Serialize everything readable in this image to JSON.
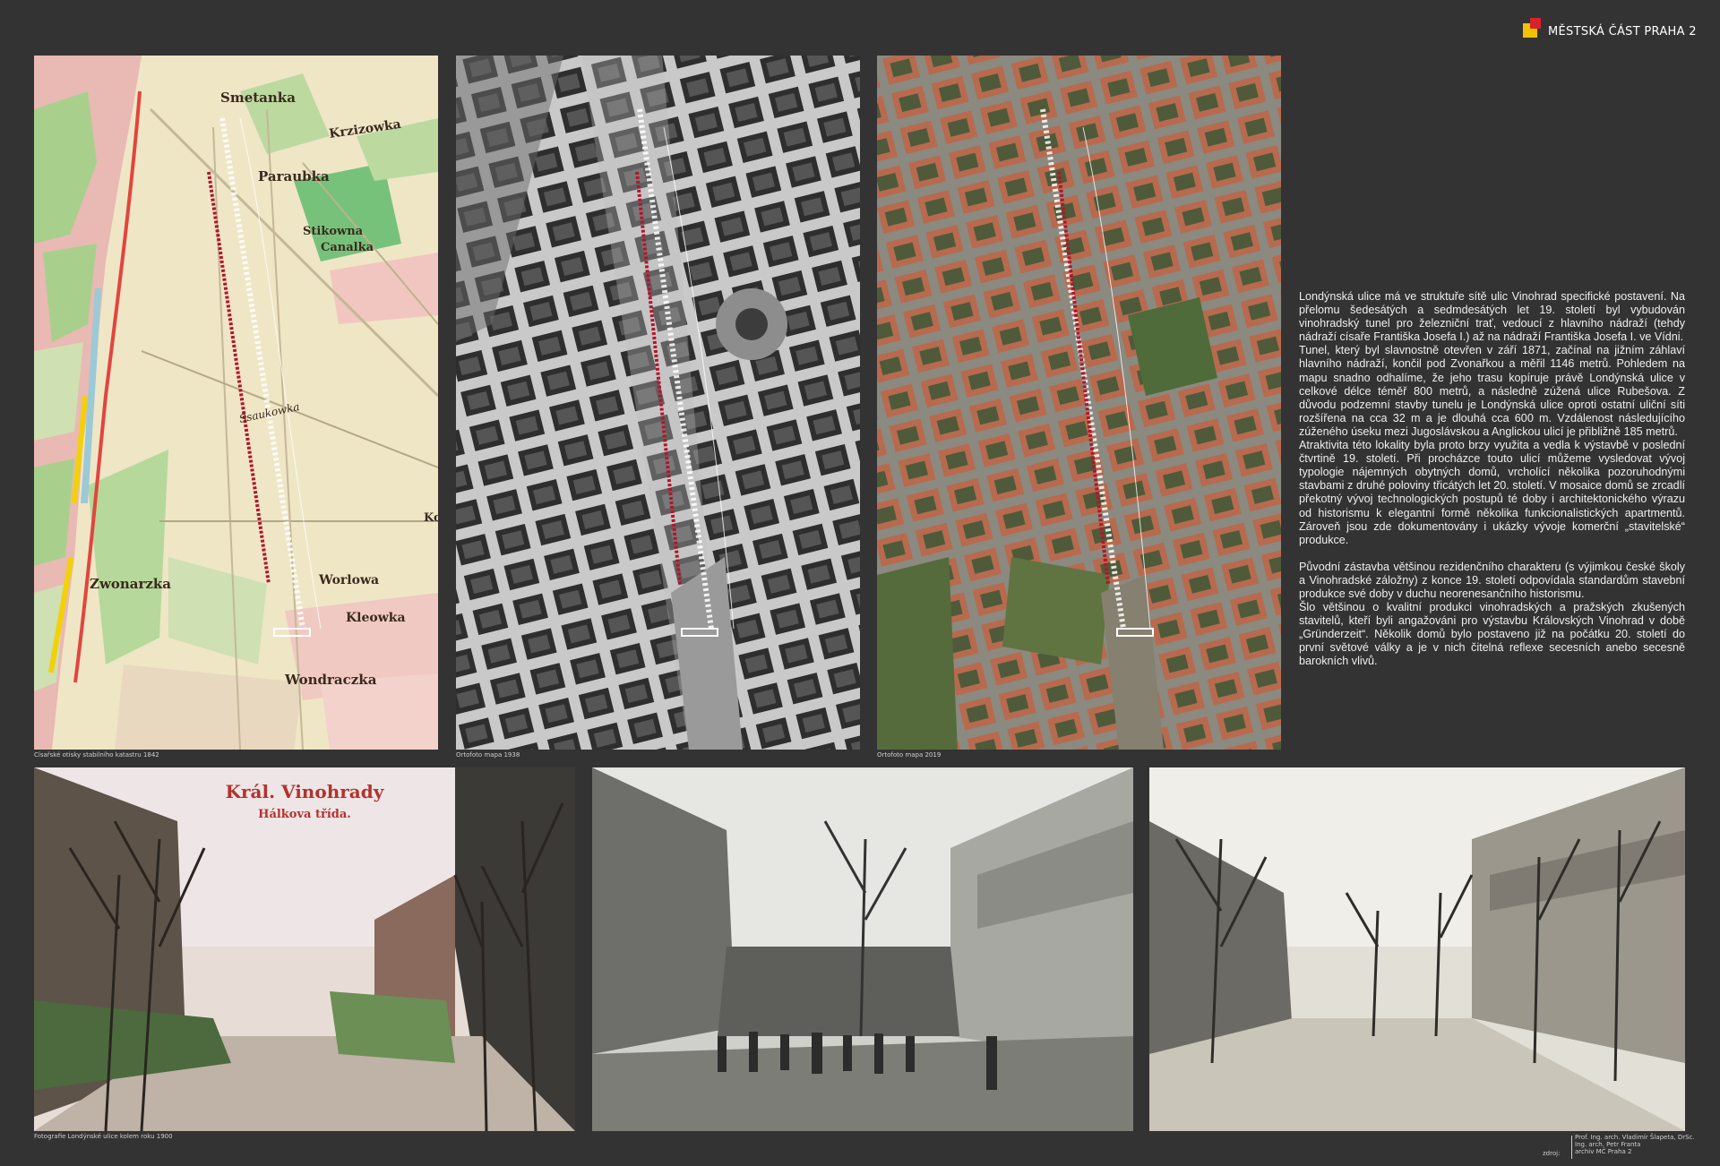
{
  "logo": {
    "text": "MĚSTSKÁ ČÁST PRAHA 2",
    "colors": {
      "yellow": "#f2c200",
      "red": "#d8222a"
    }
  },
  "maps": [
    {
      "caption": "Císařské otisky stabilního katastru 1842",
      "labels": [
        "Smetanka",
        "Krzizowka",
        "Paraubka",
        "Stikowna",
        "Canalka",
        "Ssaukowka",
        "Worlowa",
        "Zwonarzka",
        "Kleowka",
        "Wondraczka",
        "Ko"
      ]
    },
    {
      "caption": "Ortofoto mapa 1938"
    },
    {
      "caption": "Ortofoto mapa 2019"
    }
  ],
  "article": {
    "paragraphs": [
      "Londýnská ulice má ve struktuře sítě ulic Vinohrad specifické postavení. Na přelomu šedesátých a sedmdesátých let 19. století byl vybudován vinohradský tunel pro železniční trať, vedoucí z hlavního nádraží (tehdy nádraží císaře Františka Josefa I.) až na nádraží Františka Josefa I. ve Vídni.",
      "Tunel, který byl slavnostně otevřen v září 1871, začínal na jižním záhlaví hlavního nádraží, končil pod Zvonařkou a měřil 1146 metrů. Pohledem na mapu snadno odhalíme, že jeho trasu kopíruje právě Londýnská ulice v celkové délce téměř 800 metrů, a následně zúžená ulice Rubešova. Z důvodu podzemní stavby tunelu je Londýnská ulice oproti ostatní uliční síti rozšířena na cca 32 m a je dlouhá cca 600 m. Vzdálenost následujícího zúženého úseku mezi Jugoslávskou a Anglickou ulicí je přibližně 185 metrů.",
      "Atraktivita této lokality byla proto brzy využita a vedla k výstavbě v poslední čtvrtině 19. století. Při procházce touto ulicí můžeme vysledovat vývoj typologie nájemných obytných domů, vrcholící několika pozoruhodnými stavbami z druhé poloviny třicátých let 20. století. V mosaice domů se zrcadlí překotný vývoj technologických postupů té doby i architektonického výrazu od historismu k elegantní formě několika funkcionalistických apartmentů. Zároveň jsou zde dokumentovány i ukázky vývoje komerční „stavitelské“ produkce.",
      "Původní zástavba většinou rezidenčního charakteru (s výjimkou české školy a Vinohradské záložny) z konce 19. století odpovídala standardům stavební produkce své doby v duchu neorenesančního historismu.",
      "Šlo většinou o kvalitní produkci vinohradských a pražských zkušených stavitelů, kteří byli angažováni pro výstavbu Královských Vinohrad v době „Gründerzeit“. Několik domů bylo postaveno již na počátku 20. století do první světové války a je v nich čitelná reflexe secesních anebo secesně barokních vlivů."
    ]
  },
  "photos": [
    {
      "caption": "Fotografie Londýnské ulice kolem roku 1900",
      "title": "Král. Vinohrady",
      "subtitle": "Hálkova třída."
    },
    {
      "caption": ""
    },
    {
      "caption": ""
    }
  ],
  "credits": {
    "source_label": "zdroj:",
    "names": [
      "Prof. Ing. arch. Vladimír Šlapeta, DrSc.",
      "Ing. arch. Petr Franta",
      "archiv MČ Praha 2"
    ]
  }
}
